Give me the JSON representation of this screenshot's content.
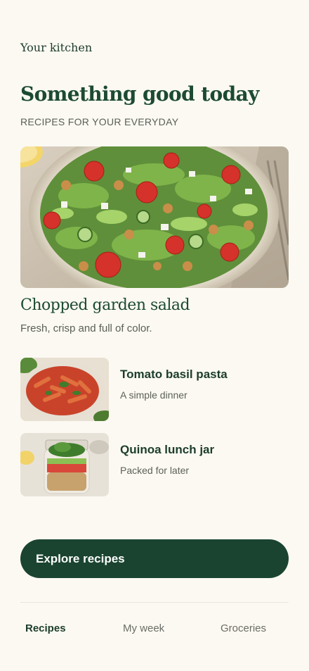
{
  "header": {
    "label": "Your kitchen"
  },
  "hero": {
    "title": "Something good today",
    "subtitle": "RECIPES FOR YOUR EVERYDAY"
  },
  "featured": {
    "image": "chopped-garden-salad-photo",
    "title": "Chopped garden salad",
    "description": "Fresh, crisp and full of color."
  },
  "recipes": [
    {
      "image": "tomato-basil-pasta-photo",
      "name": "Tomato basil pasta",
      "note": "A simple dinner"
    },
    {
      "image": "quinoa-lunch-jar-photo",
      "name": "Quinoa lunch jar",
      "note": "Packed for later"
    }
  ],
  "cta": {
    "label": "Explore recipes"
  },
  "nav": {
    "items": [
      {
        "label": "Recipes",
        "active": true
      },
      {
        "label": "My week",
        "active": false
      },
      {
        "label": "Groceries",
        "active": false
      }
    ]
  },
  "colors": {
    "background": "#fbf9f2",
    "accent": "#1a4430",
    "text_muted": "#5a5f55"
  }
}
